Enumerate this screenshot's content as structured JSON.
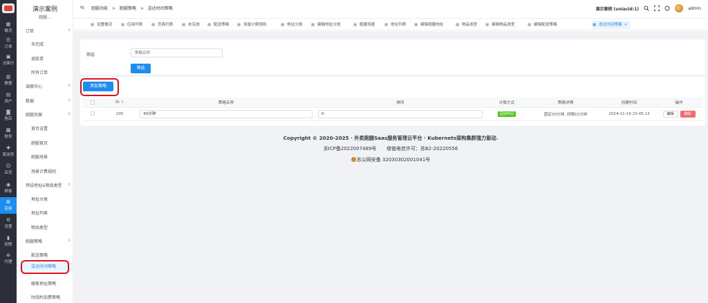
{
  "rail": {
    "items": [
      {
        "label": "概况",
        "icon": "grid-icon",
        "glyph": "▦",
        "active": false
      },
      {
        "label": "订单",
        "icon": "list-icon",
        "glyph": "☰",
        "active": false
      },
      {
        "label": "当面付",
        "icon": "wallet-icon",
        "glyph": "▣",
        "active": false
      },
      {
        "label": "数据",
        "icon": "bar-chart-icon",
        "glyph": "▥",
        "active": false
      },
      {
        "label": "商户",
        "icon": "store-icon",
        "glyph": "▤",
        "active": false
      },
      {
        "label": "售后",
        "icon": "headset-icon",
        "glyph": "◙",
        "active": false
      },
      {
        "label": "财务",
        "icon": "money-icon",
        "glyph": "▩",
        "active": false
      },
      {
        "label": "配送员",
        "icon": "courier-icon",
        "glyph": "✚",
        "active": false
      },
      {
        "label": "店员",
        "icon": "staff-icon",
        "glyph": "☺",
        "active": false
      },
      {
        "label": "顾客",
        "icon": "customer-icon",
        "glyph": "◉",
        "active": false
      },
      {
        "label": "应用",
        "icon": "apps-icon",
        "glyph": "⊞",
        "active": true
      },
      {
        "label": "设置",
        "icon": "settings-icon",
        "glyph": "⚙",
        "active": false
      },
      {
        "label": "权限",
        "icon": "lock-icon",
        "glyph": "▮",
        "active": false
      },
      {
        "label": "代理",
        "icon": "agent-icon",
        "glyph": "⊛",
        "active": false
      }
    ]
  },
  "submenu": {
    "title": "演示案例",
    "subtitle": "跑腿...",
    "groups": [
      {
        "label": "订单",
        "arrow": "∨"
      },
      {
        "label": "调度中心",
        "arrow": "∨"
      },
      {
        "label": "数据",
        "arrow": "∨"
      },
      {
        "label": "跑腿页面",
        "arrow": "∧"
      },
      {
        "label": "预设地址&物品类型",
        "arrow": "∧"
      },
      {
        "label": "跑腿策略",
        "arrow": "∧"
      }
    ],
    "leaves": [
      {
        "label": "未完成"
      },
      {
        "label": "退款单"
      },
      {
        "label": "所有订单"
      },
      {
        "label": "首页设置"
      },
      {
        "label": "跑腿首页"
      },
      {
        "label": "跑腿场景"
      },
      {
        "label": "场景计费规则"
      },
      {
        "label": "地址分类"
      },
      {
        "label": "地址列表"
      },
      {
        "label": "物品类型"
      },
      {
        "label": "配送策略"
      },
      {
        "label": "送达时间策略"
      },
      {
        "label": "跟客地址策略"
      },
      {
        "label": "时段附加费策略"
      }
    ]
  },
  "topbar": {
    "toggle": "⇆",
    "breadcrumbs": [
      "跑腿功能",
      ">",
      "跑腿策略",
      ">",
      "送达时间策略"
    ],
    "account": "演示案例 (uniacid:1)",
    "user": "admin"
  },
  "tabs": [
    {
      "label": "设置概况"
    },
    {
      "label": "应用列表"
    },
    {
      "label": "页面列表"
    },
    {
      "label": "未完成"
    },
    {
      "label": "配送策略"
    },
    {
      "label": "场景计费规则"
    },
    {
      "label": "地址分类"
    },
    {
      "label": "编辑地址分类"
    },
    {
      "label": "跑腿场景"
    },
    {
      "label": "地址列表"
    },
    {
      "label": "编辑跑腿地址"
    },
    {
      "label": "物品类型"
    },
    {
      "label": "编辑物品类型"
    },
    {
      "label": "编辑配送策略"
    },
    {
      "label": "送达时间策略",
      "close": "×"
    }
  ],
  "filter": {
    "label": "筛选",
    "placeholder": "策略名称",
    "button": "筛选"
  },
  "list": {
    "add_button": "添加策略",
    "columns": [
      "ID",
      "策略名称",
      "排序",
      "计算方式",
      "策略详情",
      "创建时间",
      "操作"
    ],
    "sort_glyph": "⇅",
    "rows": [
      {
        "id": "205",
        "name": "30分钟",
        "sort": "0",
        "method": "固定时间",
        "detail": "固定30分钟, 间隔15分钟",
        "created": "2024-11-19 23:45:13",
        "edit": "编辑",
        "delete": "删除"
      }
    ]
  },
  "footer": {
    "line1": "Copyright © 2020-2025 · 外卖跑腿Saas服务管理云平台 · Kubernets架构集群强力驱动.",
    "icp": "苏ICP备2022007489号",
    "license": "增值电信许可：苏B2-20220556",
    "police": "苏公网安备 32030302001041号"
  },
  "colors": {
    "primary": "#1f8cf0",
    "rail": "#2b2f3a",
    "danger": "#f56c6c",
    "success": "#52c41a",
    "highlight": "#e0101a"
  }
}
